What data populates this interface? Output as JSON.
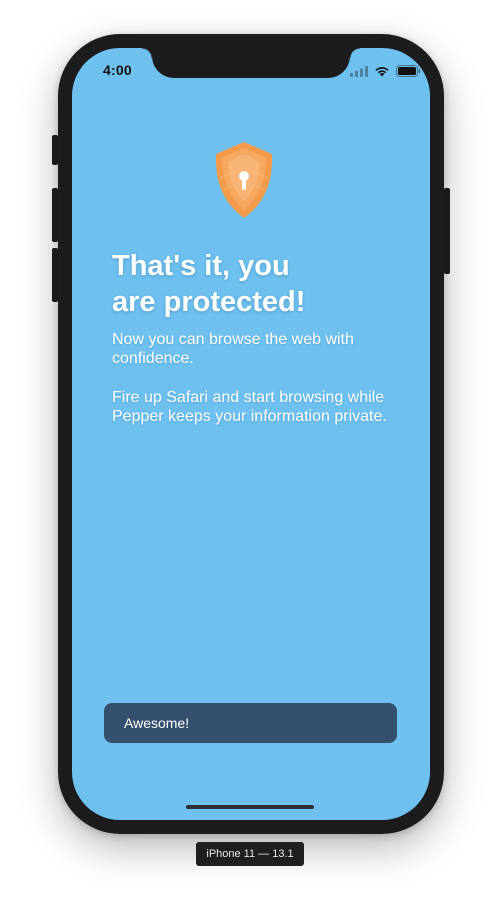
{
  "status_bar": {
    "time": "4:00",
    "icons": [
      "cellular-signal-icon",
      "wifi-icon",
      "battery-icon"
    ]
  },
  "onboarding": {
    "icon": "shield-lock-icon",
    "title_line1": "That's it, you",
    "title_line2": "are protected!",
    "paragraph1": "Now you can browse the web with confidence.",
    "paragraph2": "Fire up Safari and start browsing while Pepper keeps your information private.",
    "primary_button": "Awesome!"
  },
  "simulator": {
    "device_label": "iPhone 11 — 13.1"
  },
  "colors": {
    "screen_background": "#6ec1ef",
    "button_background": "#35506f",
    "shield_orange": "#f39a4b",
    "device_frame": "#1c1c1e"
  }
}
